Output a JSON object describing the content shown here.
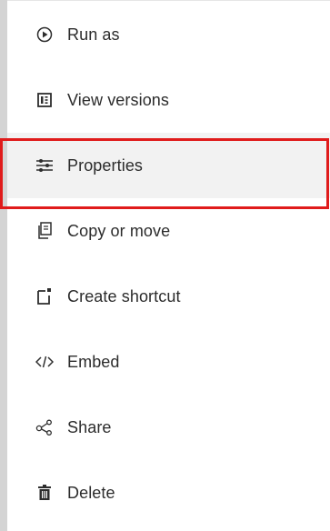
{
  "menu": {
    "items": [
      {
        "label": "Run as",
        "icon": "play-circle-icon"
      },
      {
        "label": "View versions",
        "icon": "versions-icon"
      },
      {
        "label": "Properties",
        "icon": "sliders-icon"
      },
      {
        "label": "Copy or move",
        "icon": "copy-icon"
      },
      {
        "label": "Create shortcut",
        "icon": "shortcut-icon"
      },
      {
        "label": "Embed",
        "icon": "code-icon"
      },
      {
        "label": "Share",
        "icon": "share-icon"
      },
      {
        "label": "Delete",
        "icon": "trash-icon"
      }
    ],
    "selected_index": 2
  },
  "colors": {
    "highlight": "#e01b1b",
    "text": "#2c2c2c",
    "selected_bg": "#f2f2f2"
  }
}
